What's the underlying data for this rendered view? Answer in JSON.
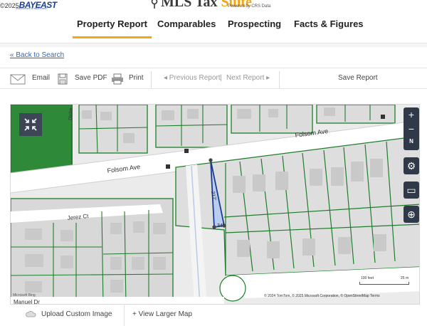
{
  "corner": {
    "copyright": "©2025",
    "logo": "BAYEAST",
    "logo_tagline": "ASSOCIATION OF REALTORS®"
  },
  "brand": {
    "name_part1": "MLS Tax",
    "name_part2": "Suite",
    "powered_by": "Powered by CRS Data"
  },
  "nav": {
    "items": [
      {
        "label": "Property Report",
        "active": true
      },
      {
        "label": "Comparables",
        "active": false
      },
      {
        "label": "Prospecting",
        "active": false
      },
      {
        "label": "Facts & Figures",
        "active": false
      }
    ]
  },
  "back_link": "« Back to Search",
  "toolbar": {
    "email": "Email",
    "save_pdf": "Save PDF",
    "print": "Print",
    "prev": "◂ Previous Report",
    "sep": "|",
    "next": "Next Report ▸",
    "save_report": "Save Report"
  },
  "map": {
    "streets": {
      "folsom_upper": "Folsom Ave",
      "folsom_lower": "Folsom Ave",
      "jerez": "Jerez Ct",
      "dickens": "Dicke",
      "manuel": "Manuel Dr"
    },
    "parcel_labels": {
      "side": "217'",
      "front": "34'"
    },
    "scale": {
      "feet": "100 feet",
      "meters": "25 m"
    },
    "attribution": "© 2024 TomTom, © 2025 Microsoft Corporation, © OpenStreetMap   Terms",
    "microsoft_logo": "Microsoft Bing",
    "controls": {
      "zoom_in": "+",
      "zoom_out": "−",
      "north": "N",
      "settings": "⚙",
      "select": "▭",
      "locate": "⊕"
    },
    "colors": {
      "parcel_line": "#1e7d2a",
      "road": "#ffffff",
      "park": "#2e8a38",
      "selected_parcel": "#b9cdf0",
      "control_bg": "#2f3947"
    }
  },
  "footer": {
    "upload": "Upload Custom Image",
    "larger": "+ View Larger Map"
  }
}
